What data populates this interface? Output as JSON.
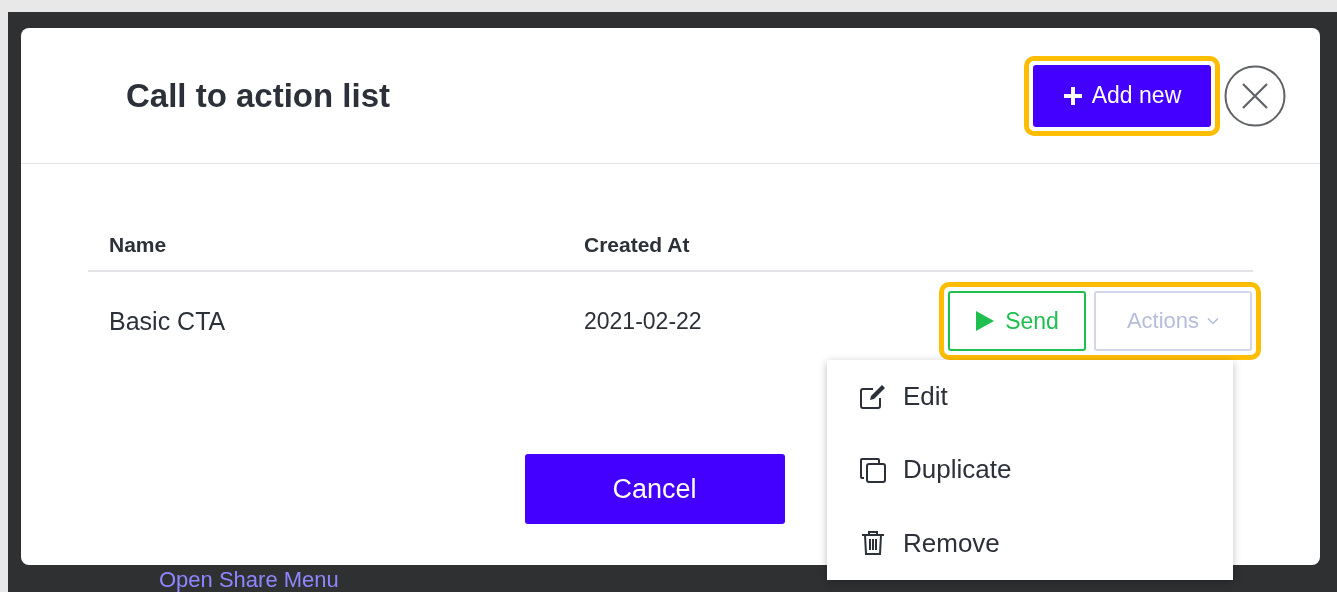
{
  "modal": {
    "title": "Call to action list",
    "add_button": {
      "label": "Add new",
      "highlighted": true
    },
    "table": {
      "columns": [
        "Name",
        "Created At"
      ],
      "rows": [
        {
          "name": "Basic CTA",
          "created_at": "2021-02-22",
          "send_label": "Send",
          "actions_label": "Actions",
          "actions_highlighted": true
        }
      ]
    },
    "actions_menu": {
      "expanded": true,
      "items": [
        {
          "kind": "edit",
          "label": "Edit"
        },
        {
          "kind": "duplicate",
          "label": "Duplicate"
        },
        {
          "kind": "remove",
          "label": "Remove"
        }
      ]
    },
    "cancel_button": "Cancel"
  },
  "background_link": "Open Share Menu"
}
